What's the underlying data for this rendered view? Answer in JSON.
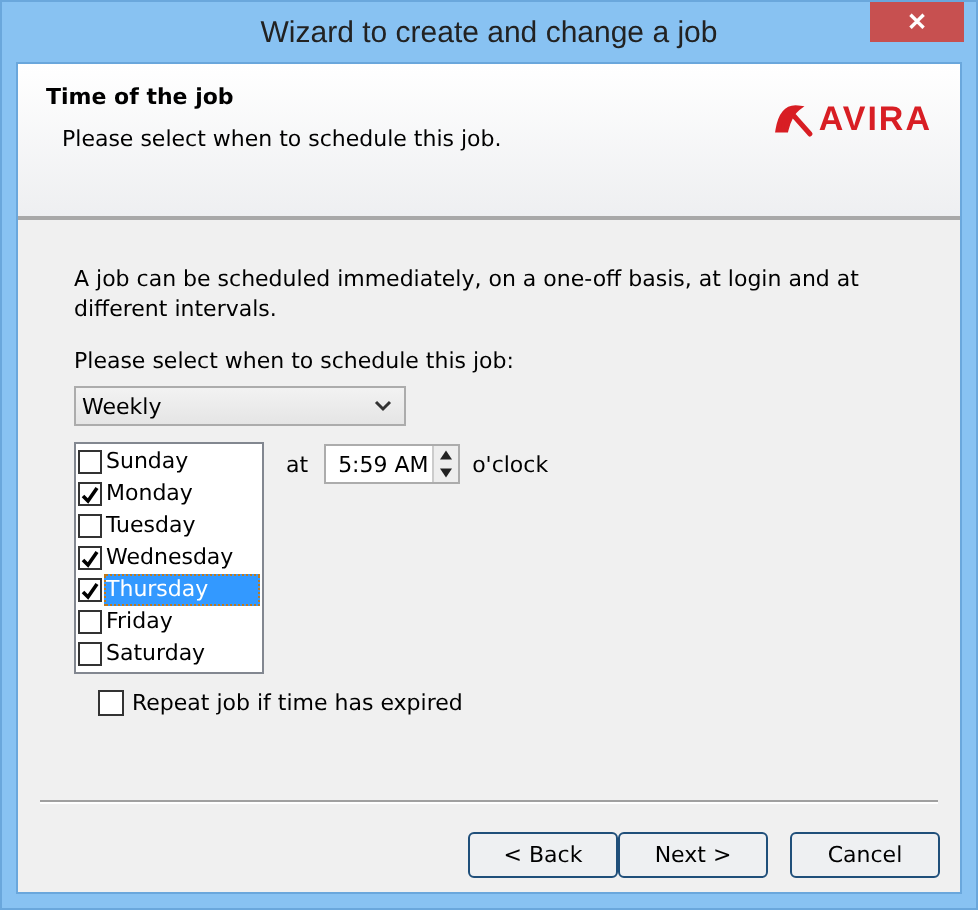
{
  "window": {
    "title": "Wizard to create and change a job",
    "close": "✕"
  },
  "header": {
    "title": "Time of the job",
    "subtitle": "Please select when to schedule this job.",
    "logo": "AVIRA"
  },
  "intro": "A job can be scheduled immediately, on a one-off basis, at login and at different intervals.",
  "schedule_label": "Please select when to schedule this job:",
  "schedule_dropdown": {
    "value": "Weekly"
  },
  "days": [
    {
      "label": "Sunday",
      "checked": false,
      "selected": false
    },
    {
      "label": "Monday",
      "checked": true,
      "selected": false
    },
    {
      "label": "Tuesday",
      "checked": false,
      "selected": false
    },
    {
      "label": "Wednesday",
      "checked": true,
      "selected": false
    },
    {
      "label": "Thursday",
      "checked": true,
      "selected": true
    },
    {
      "label": "Friday",
      "checked": false,
      "selected": false
    },
    {
      "label": "Saturday",
      "checked": false,
      "selected": false
    }
  ],
  "at_label": "at",
  "time": {
    "value": "5:59 AM"
  },
  "oclock_label": "o'clock",
  "repeat": {
    "label": "Repeat job if time has expired",
    "checked": false
  },
  "buttons": [
    {
      "label": "< Back"
    },
    {
      "label": "Next >"
    },
    {
      "label": "Cancel"
    }
  ]
}
